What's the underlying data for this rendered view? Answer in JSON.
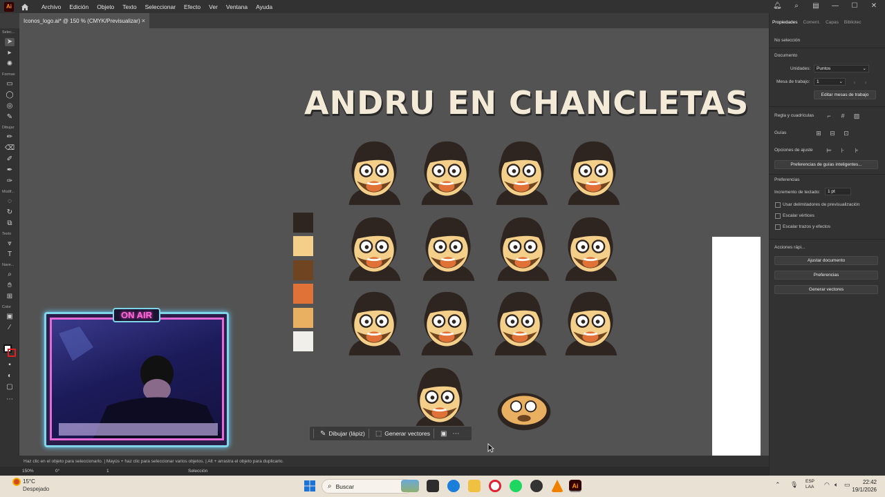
{
  "menubar": {
    "app_logo": "Ai",
    "items": [
      "Archivo",
      "Edición",
      "Objeto",
      "Texto",
      "Seleccionar",
      "Efecto",
      "Ver",
      "Ventana",
      "Ayuda"
    ]
  },
  "document_tab": {
    "title": "Iconos_logo.ai* @ 150 % (CMYK/Previsualizar)",
    "close": "×"
  },
  "toolbar": {
    "labels": [
      "Selec...",
      "Formas",
      "Dibujar",
      "Modif...",
      "Texto",
      "Nave...",
      "Color"
    ]
  },
  "artwork": {
    "title": "ANDRU EN CHANCLETAS",
    "palette": [
      "#2e2520",
      "#f3cf8a",
      "#6e4520",
      "#e07238",
      "#e8b060",
      "#f1efea"
    ],
    "emote_count": 14
  },
  "overlay": {
    "badge": "ON AIR"
  },
  "context_bar": {
    "draw_label": "Dibujar (lápiz)",
    "generate_label": "Generar vectores"
  },
  "status": {
    "hint": "Haz clic en el objeto para seleccionarlo.  |  Mayús + haz clic para seleccionar varios objetos.  |  Alt + arrastra el objeto para duplicarlo.",
    "zoom": "150%",
    "rotation": "0°",
    "artboard": "1",
    "tool": "Selección"
  },
  "right_panel": {
    "tabs": [
      "Propiedades",
      "Coment.",
      "Capas",
      "Bibliotec"
    ],
    "no_selection": "No selección",
    "document_heading": "Documento",
    "units_label": "Unidades:",
    "units_value": "Puntos",
    "artboard_label": "Mesa de trabajo:",
    "artboard_value": "1",
    "edit_artboards": "Editar mesas de trabajo",
    "rulers_grids": "Regla y cuadrículas",
    "guides": "Guías",
    "snap_options": "Opciones de ajuste",
    "smart_guides_prefs": "Preferencias de guías inteligentes...",
    "preferences_heading": "Preferencias",
    "keyboard_increment_label": "Incremento de teclado:",
    "keyboard_increment_value": "1 pt",
    "checkbox_preview_bounds": "Usar delimitadores de previsualización",
    "checkbox_scale_corners": "Escalar vértices",
    "checkbox_scale_strokes": "Escalar trazos y efectos",
    "quick_actions_heading": "Acciones rápi...",
    "btn_fit_document": "Ajustar documento",
    "btn_preferences": "Preferencias",
    "btn_generate_vectors": "Generar vectores"
  },
  "taskbar": {
    "weather_temp": "15°C",
    "weather_desc": "Despejado",
    "search_placeholder": "Buscar",
    "lang_1": "ESP",
    "lang_2": "LAA",
    "time": "22:42",
    "date": "19/1/2026"
  }
}
